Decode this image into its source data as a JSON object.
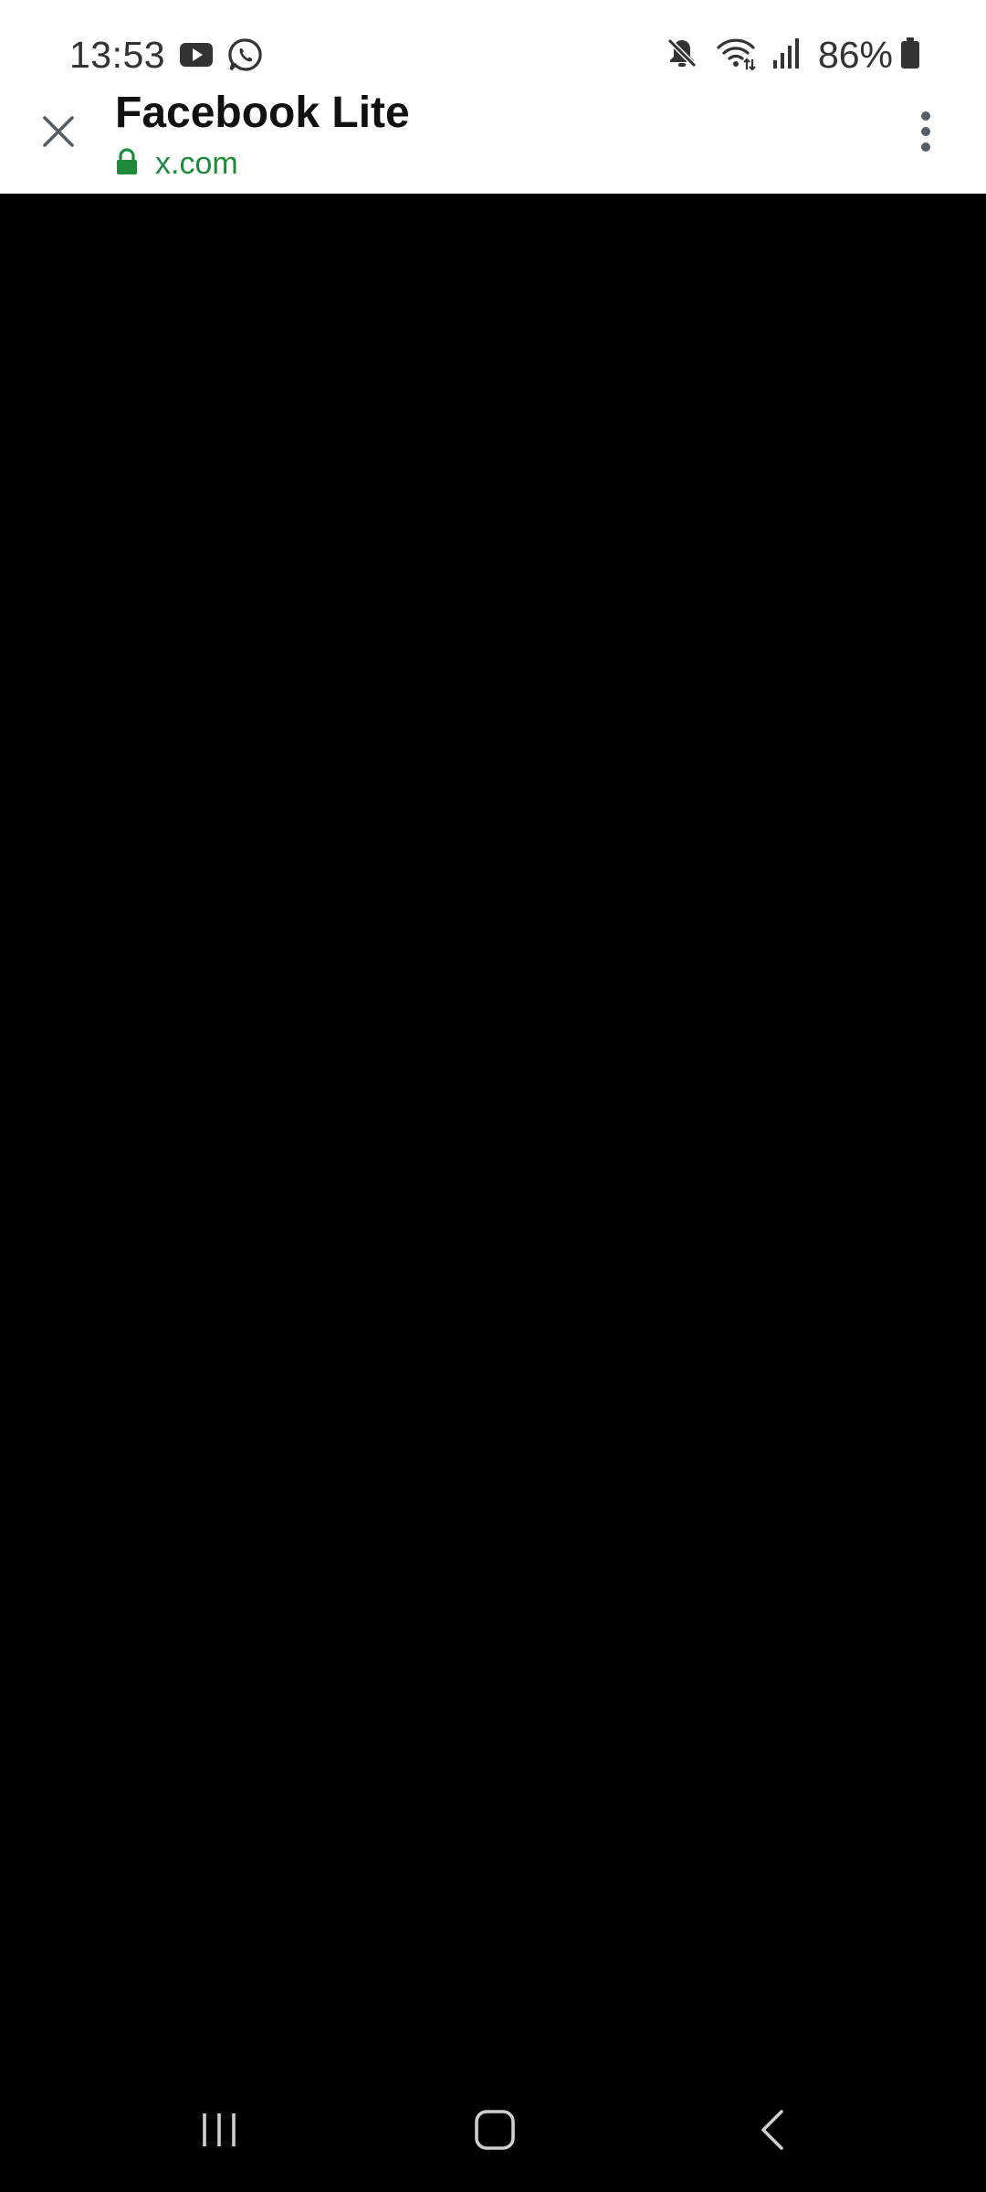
{
  "status_bar": {
    "time": "13:53",
    "battery_percent": "86%",
    "notification_icons": [
      "youtube-icon",
      "whatsapp-icon"
    ],
    "system_icons": [
      "mute-icon",
      "wifi-icon",
      "signal-icon",
      "battery-icon"
    ]
  },
  "header": {
    "title": "Facebook Lite",
    "url": "x.com",
    "url_color": "#1f8a3b",
    "icons": [
      "close-icon",
      "lock-icon",
      "more-vert-icon"
    ]
  },
  "content": {
    "background": "#000000"
  },
  "nav_bar": {
    "icons": [
      "recents-icon",
      "home-icon",
      "back-icon"
    ]
  }
}
